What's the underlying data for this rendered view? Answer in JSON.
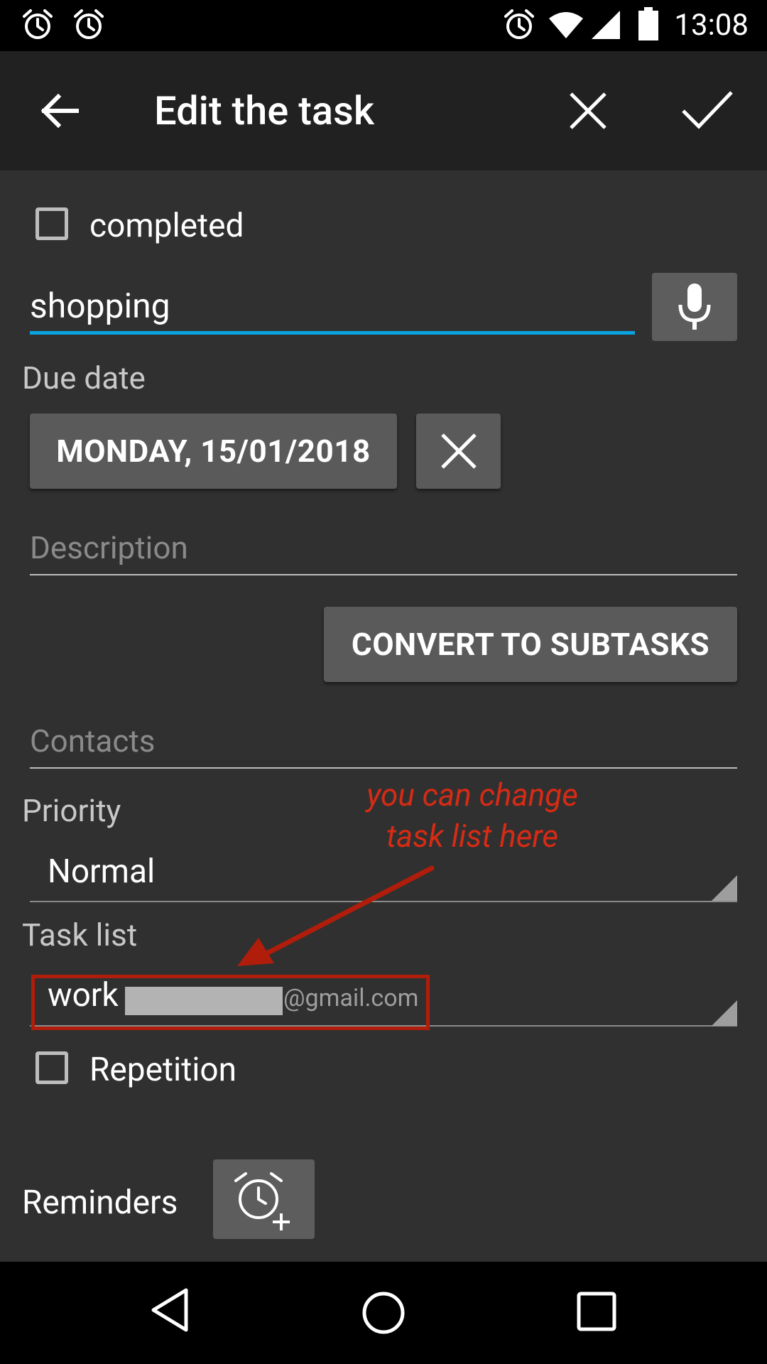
{
  "status_bar": {
    "time": "13:08",
    "icons": [
      "alarm-icon",
      "alarm-icon",
      "alarm-icon",
      "wifi-icon",
      "signal-icon",
      "battery-icon"
    ]
  },
  "app_bar": {
    "title": "Edit the task",
    "icons": [
      "back-arrow-icon",
      "close-icon",
      "check-icon"
    ]
  },
  "form": {
    "completed_label": "completed",
    "task_name_value": "shopping",
    "due_date_label": "Due date",
    "due_date_value": "MONDAY, 15/01/2018",
    "description_placeholder": "Description",
    "convert_button_label": "CONVERT TO SUBTASKS",
    "contacts_placeholder": "Contacts",
    "priority_label": "Priority",
    "priority_value": "Normal",
    "task_list_label": "Task list",
    "task_list_value": "work",
    "task_list_account": "@gmail.com",
    "repetition_label": "Repetition",
    "reminders_label": "Reminders"
  },
  "annotation": {
    "line1": "you can change",
    "line2": "task list here"
  },
  "colors": {
    "accent": "#0aa3e0",
    "annotation": "#d62b14",
    "background": "#303030",
    "app_bar": "#212121"
  }
}
